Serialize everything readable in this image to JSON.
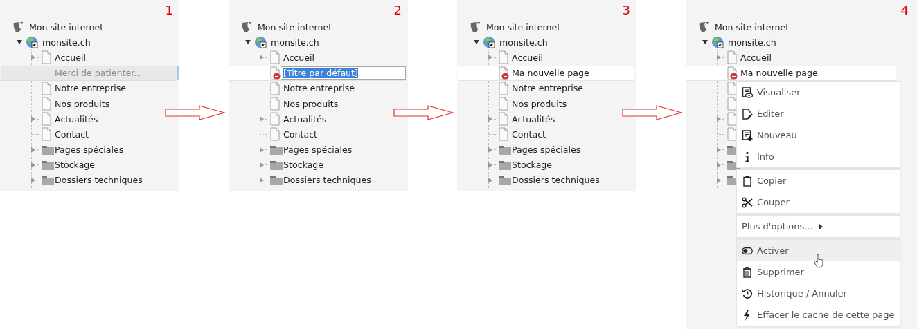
{
  "panels": [
    {
      "number": "1",
      "root": "Mon site internet",
      "site": {
        "label": "monsite.ch",
        "expanded": true
      },
      "pages": [
        {
          "label": "Accueil",
          "kind": "page",
          "expandable": true
        },
        {
          "label": "Merci de patienter...",
          "kind": "loading",
          "expandable": false
        },
        {
          "label": "Notre entreprise",
          "kind": "page",
          "expandable": false
        },
        {
          "label": "Nos produits",
          "kind": "page",
          "expandable": false
        },
        {
          "label": "Actualités",
          "kind": "page",
          "expandable": true
        },
        {
          "label": "Contact",
          "kind": "page",
          "expandable": false
        },
        {
          "label": "Pages spéciales",
          "kind": "folder",
          "expandable": true
        },
        {
          "label": "Stockage",
          "kind": "folder",
          "expandable": true
        },
        {
          "label": "Dossiers techniques",
          "kind": "folder",
          "expandable": true
        }
      ]
    },
    {
      "number": "2",
      "root": "Mon site internet",
      "site": {
        "label": "monsite.ch",
        "expanded": true
      },
      "pages": [
        {
          "label": "Accueil",
          "kind": "page",
          "expandable": true
        },
        {
          "value": "[Titre par défaut]",
          "kind": "editing",
          "expandable": false
        },
        {
          "label": "Notre entreprise",
          "kind": "page",
          "expandable": false
        },
        {
          "label": "Nos produits",
          "kind": "page",
          "expandable": false
        },
        {
          "label": "Actualités",
          "kind": "page",
          "expandable": true
        },
        {
          "label": "Contact",
          "kind": "page",
          "expandable": false
        },
        {
          "label": "Pages spéciales",
          "kind": "folder",
          "expandable": true
        },
        {
          "label": "Stockage",
          "kind": "folder",
          "expandable": true
        },
        {
          "label": "Dossiers techniques",
          "kind": "folder",
          "expandable": true
        }
      ]
    },
    {
      "number": "3",
      "root": "Mon site internet",
      "site": {
        "label": "monsite.ch",
        "expanded": true
      },
      "pages": [
        {
          "label": "Accueil",
          "kind": "page",
          "expandable": true
        },
        {
          "label": "Ma nouvelle page",
          "kind": "new",
          "expandable": false
        },
        {
          "label": "Notre entreprise",
          "kind": "page",
          "expandable": false
        },
        {
          "label": "Nos produits",
          "kind": "page",
          "expandable": false
        },
        {
          "label": "Actualités",
          "kind": "page",
          "expandable": true
        },
        {
          "label": "Contact",
          "kind": "page",
          "expandable": false
        },
        {
          "label": "Pages spéciales",
          "kind": "folder",
          "expandable": true
        },
        {
          "label": "Stockage",
          "kind": "folder",
          "expandable": true
        },
        {
          "label": "Dossiers techniques",
          "kind": "folder",
          "expandable": true
        }
      ]
    },
    {
      "number": "4",
      "root": "Mon site internet",
      "site": {
        "label": "monsite.ch",
        "expanded": true
      },
      "pages": [
        {
          "label": "Accueil",
          "kind": "page",
          "expandable": true
        },
        {
          "label": "Ma nouvelle page",
          "kind": "new",
          "expandable": false
        },
        {
          "kind": "page",
          "expandable": false
        },
        {
          "kind": "page",
          "expandable": false
        },
        {
          "kind": "page",
          "expandable": true
        },
        {
          "kind": "page",
          "expandable": false
        },
        {
          "kind": "folder",
          "expandable": true
        },
        {
          "kind": "folder",
          "expandable": true
        },
        {
          "kind": "folder",
          "expandable": true
        }
      ],
      "context_menu": {
        "groups": [
          [
            {
              "label": "Visualiser",
              "hovered": false,
              "submenu": false
            },
            {
              "label": "Éditer",
              "hovered": false,
              "submenu": false
            },
            {
              "label": "Nouveau",
              "hovered": false,
              "submenu": false
            },
            {
              "label": "Info",
              "hovered": false,
              "submenu": false
            }
          ],
          [
            {
              "label": "Copier",
              "hovered": false,
              "submenu": false
            },
            {
              "label": "Couper",
              "hovered": false,
              "submenu": false
            }
          ],
          [
            {
              "label": "Plus d'options...",
              "hovered": false,
              "submenu": true
            }
          ],
          [
            {
              "label": "Activer",
              "hovered": true,
              "submenu": false
            },
            {
              "label": "Supprimer",
              "hovered": false,
              "submenu": false
            },
            {
              "label": "Historique / Annuler",
              "hovered": false,
              "submenu": false
            },
            {
              "label": "Effacer le cache de cette page",
              "hovered": false,
              "submenu": false
            }
          ]
        ]
      }
    }
  ]
}
